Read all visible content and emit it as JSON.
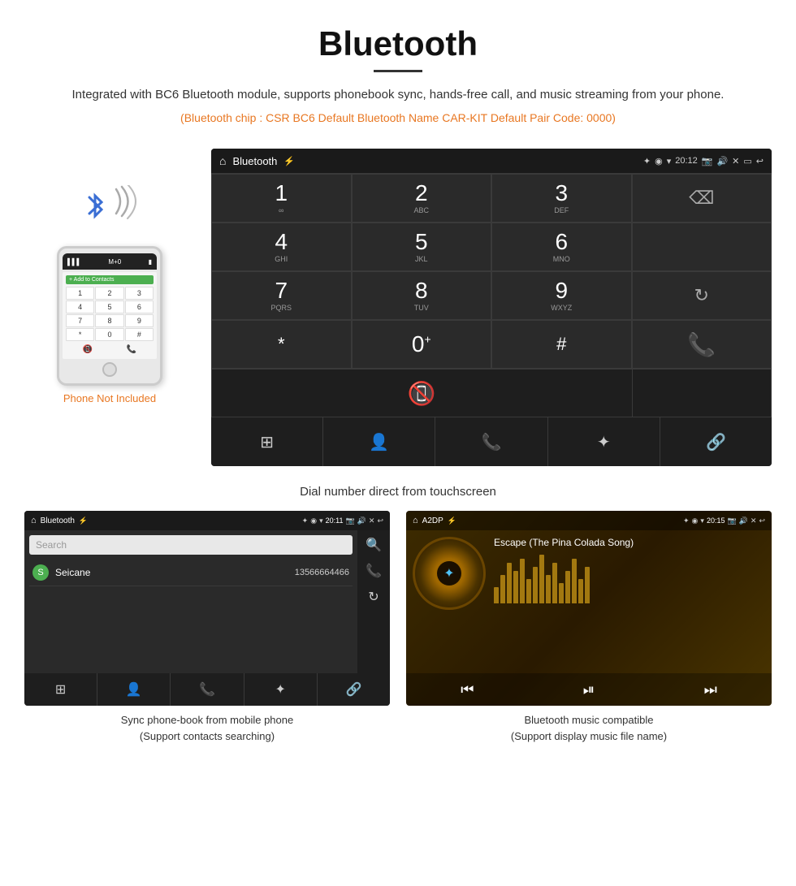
{
  "header": {
    "title": "Bluetooth",
    "description": "Integrated with BC6 Bluetooth module, supports phonebook sync, hands-free call, and music streaming from your phone.",
    "specs": "(Bluetooth chip : CSR BC6    Default Bluetooth Name CAR-KIT    Default Pair Code: 0000)"
  },
  "dialpad": {
    "screen_title": "Bluetooth",
    "time": "20:12",
    "keys": [
      {
        "num": "1",
        "sub": ""
      },
      {
        "num": "2",
        "sub": "ABC"
      },
      {
        "num": "3",
        "sub": "DEF"
      },
      {
        "num": "4",
        "sub": "GHI"
      },
      {
        "num": "5",
        "sub": "JKL"
      },
      {
        "num": "6",
        "sub": "MNO"
      },
      {
        "num": "7",
        "sub": "PQRS"
      },
      {
        "num": "8",
        "sub": "TUV"
      },
      {
        "num": "9",
        "sub": "WXYZ"
      },
      {
        "num": "*",
        "sub": ""
      },
      {
        "num": "0",
        "sub": "+"
      },
      {
        "num": "#",
        "sub": ""
      }
    ],
    "caption": "Dial number direct from touchscreen"
  },
  "phone_mockup": {
    "not_included": "Phone Not Included",
    "contact_text": "+ Add to Contacts",
    "dial_keys": [
      "1",
      "2",
      "3",
      "4",
      "5",
      "6",
      "7",
      "8",
      "9",
      "*",
      "0",
      "#"
    ]
  },
  "phonebook": {
    "screen_title": "Bluetooth",
    "time": "20:11",
    "search_placeholder": "Search",
    "contact_name": "Seicane",
    "contact_number": "13566664466",
    "caption_line1": "Sync phone-book from mobile phone",
    "caption_line2": "(Support contacts searching)"
  },
  "music": {
    "screen_title": "A2DP",
    "time": "20:15",
    "song_title": "Escape (The Pina Colada Song)",
    "caption_line1": "Bluetooth music compatible",
    "caption_line2": "(Support display music file name)",
    "bars": [
      20,
      35,
      50,
      40,
      55,
      30,
      45,
      60,
      35,
      50,
      25,
      40,
      55,
      30,
      45
    ]
  },
  "icons": {
    "bluetooth": "✦",
    "home": "⌂",
    "back": "↩",
    "grid": "⊞",
    "person": "👤",
    "phone": "📞",
    "link": "🔗",
    "search": "🔍",
    "refresh": "↻",
    "backspace": "⌫",
    "call_green": "📞",
    "call_end": "📵",
    "prev": "⏮",
    "play": "⏯",
    "next": "⏭"
  }
}
